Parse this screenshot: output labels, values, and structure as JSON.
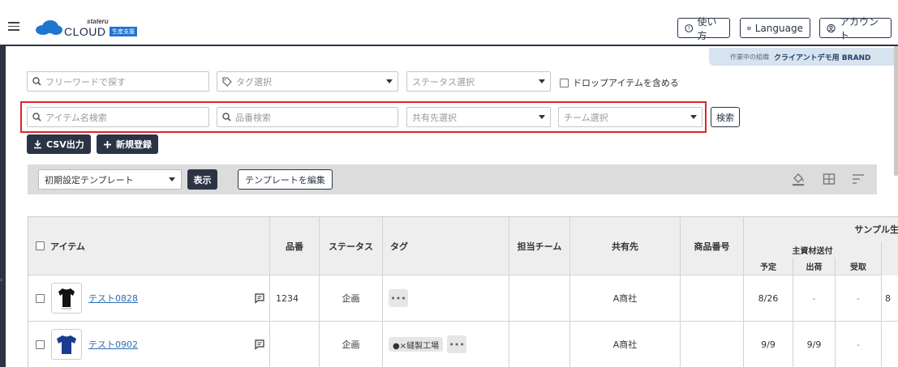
{
  "header": {
    "brand_small": "stateru",
    "brand_main": "CLOUD",
    "brand_tag": "生産支援",
    "help_label": "使い方",
    "language_label": "Language",
    "account_label": "アカウント"
  },
  "org": {
    "prefix": "作業中の組織",
    "name": "クライアントデモ用 BRAND"
  },
  "filters": {
    "freeword_placeholder": "フリーワードで探す",
    "tag_placeholder": "タグ選択",
    "status_placeholder": "ステータス選択",
    "include_drop_label": "ドロップアイテムを含める",
    "item_name_placeholder": "アイテム名検索",
    "product_no_placeholder": "品番検索",
    "share_placeholder": "共有先選択",
    "team_placeholder": "チーム選択",
    "search_label": "検索"
  },
  "actions": {
    "csv_label": "CSV出力",
    "new_label": "新規登録"
  },
  "template": {
    "selected": "初期設定テンプレート",
    "show_label": "表示",
    "edit_label": "テンプレートを編集"
  },
  "table": {
    "headers": {
      "item": "アイテム",
      "product_no": "品番",
      "status": "ステータス",
      "tag": "タグ",
      "team": "担当チーム",
      "share": "共有先",
      "code": "商品番号",
      "sample_group": "サンプル生",
      "main_material": "主資材送付",
      "planned": "予定",
      "shipped": "出荷",
      "received": "受取"
    },
    "rows": [
      {
        "name": "テスト0828",
        "product_no": "1234",
        "status": "企画",
        "tags": [],
        "team": "",
        "share": "A商社",
        "code": "",
        "planned": "8/26",
        "shipped": "-",
        "received": "-",
        "extra": "8"
      },
      {
        "name": "テスト0902",
        "product_no": "",
        "status": "企画",
        "tags": [
          "●×縫製工場"
        ],
        "team": "",
        "share": "A商社",
        "code": "",
        "planned": "9/9",
        "shipped": "9/9",
        "received": "-",
        "extra": ""
      }
    ]
  },
  "colors": {
    "primary": "#2b3445",
    "highlight": "#e0242a",
    "link": "#2e6fb0",
    "org_banner": "#d7e3ef"
  }
}
